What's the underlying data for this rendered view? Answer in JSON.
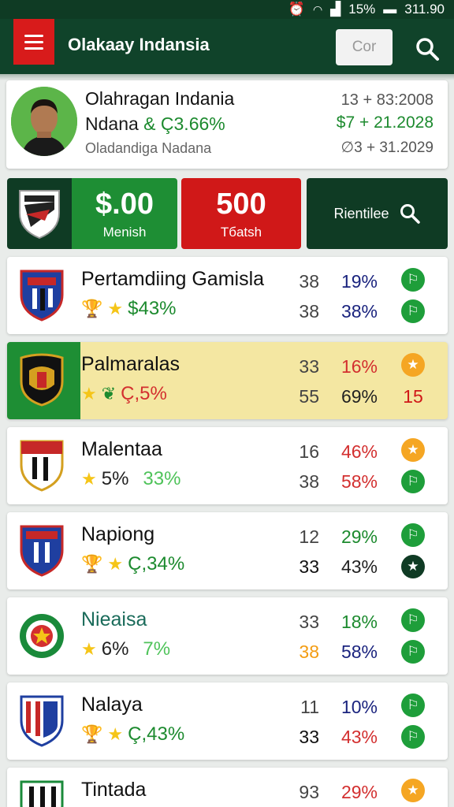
{
  "status": {
    "time": "311.90",
    "battery": "15%"
  },
  "appbar": {
    "title": "Olakaay Indansia",
    "search_text": "Cor"
  },
  "profile": {
    "name": "Olahragan Indania",
    "subtitle_name": "Ndana",
    "subtitle_value": "& Ç3.66%",
    "small": "Oladandiga  Nadana",
    "r1": "13 + 83:2008",
    "r2": "$7 + 21.2028",
    "r3": "∅3 + 31.2029"
  },
  "summary": {
    "club_value": "$.00",
    "club_label": "Menish",
    "red_value": "500",
    "red_label": "Tбatsh",
    "dark_label": "Rientilee"
  },
  "colors": {
    "appbar": "#10432a",
    "accent_green": "#1e8e34",
    "accent_red": "#d01818",
    "highlight": "#f4e7a2"
  },
  "rows": [
    {
      "name": "Pertamdiing Gamisla",
      "icons": [
        "trophy-icon",
        "star-icon"
      ],
      "stat": "$43%",
      "stat_color": "green",
      "stat2": "",
      "n1": "38",
      "n2": "38",
      "p1": "19%",
      "p1_color": "navy",
      "p2": "38%",
      "p2_color": "navy",
      "b1": "green",
      "b2": "green",
      "b2_text": ""
    },
    {
      "name": "Palmaralas",
      "icons": [
        "star-icon",
        "leaf-icon"
      ],
      "stat": "Ç,5%",
      "stat_color": "red",
      "stat2": "",
      "n1": "33",
      "n2": "55",
      "p1": "16%",
      "p1_color": "red",
      "p2": "69%",
      "p2_color": "dark",
      "b1": "orange",
      "b2": "",
      "b2_text": "15"
    },
    {
      "name": "Malentaa",
      "icons": [
        "star-icon"
      ],
      "stat": "5%",
      "stat_color": "dark",
      "stat2": "33%",
      "n1": "16",
      "n2": "38",
      "p1": "46%",
      "p1_color": "red",
      "p2": "58%",
      "p2_color": "red",
      "b1": "orange",
      "b2": "green",
      "b2_text": ""
    },
    {
      "name": "Napiong",
      "icons": [
        "trophy-icon",
        "star-icon"
      ],
      "stat": "Ç,34%",
      "stat_color": "green",
      "stat2": "",
      "n1": "12",
      "n2": "33",
      "p1": "29%",
      "p1_color": "green",
      "p2": "43%",
      "p2_color": "dark",
      "b1": "green",
      "b2": "dark",
      "b2_text": ""
    },
    {
      "name": "Nieaisa",
      "icons": [
        "star-icon"
      ],
      "stat": "6%",
      "stat_color": "dark",
      "stat2": "7%",
      "n1": "33",
      "n2": "38",
      "p1": "18%",
      "p1_color": "green",
      "p2": "58%",
      "p2_color": "navy",
      "b1": "green",
      "b2": "green",
      "b2_text": ""
    },
    {
      "name": "Nalaya",
      "icons": [
        "trophy-icon",
        "star-icon"
      ],
      "stat": "Ç,43%",
      "stat_color": "green",
      "stat2": "",
      "n1": "11",
      "n2": "33",
      "p1": "10%",
      "p1_color": "navy",
      "p2": "43%",
      "p2_color": "red",
      "b1": "green",
      "b2": "green",
      "b2_text": ""
    },
    {
      "name": "Tintada",
      "icons": [],
      "stat": "",
      "stat_color": "dark",
      "stat2": "",
      "n1": "93",
      "n2": "",
      "p1": "29%",
      "p1_color": "red",
      "p2": "",
      "p2_color": "dark",
      "b1": "orange",
      "b2": "",
      "b2_text": ""
    }
  ]
}
